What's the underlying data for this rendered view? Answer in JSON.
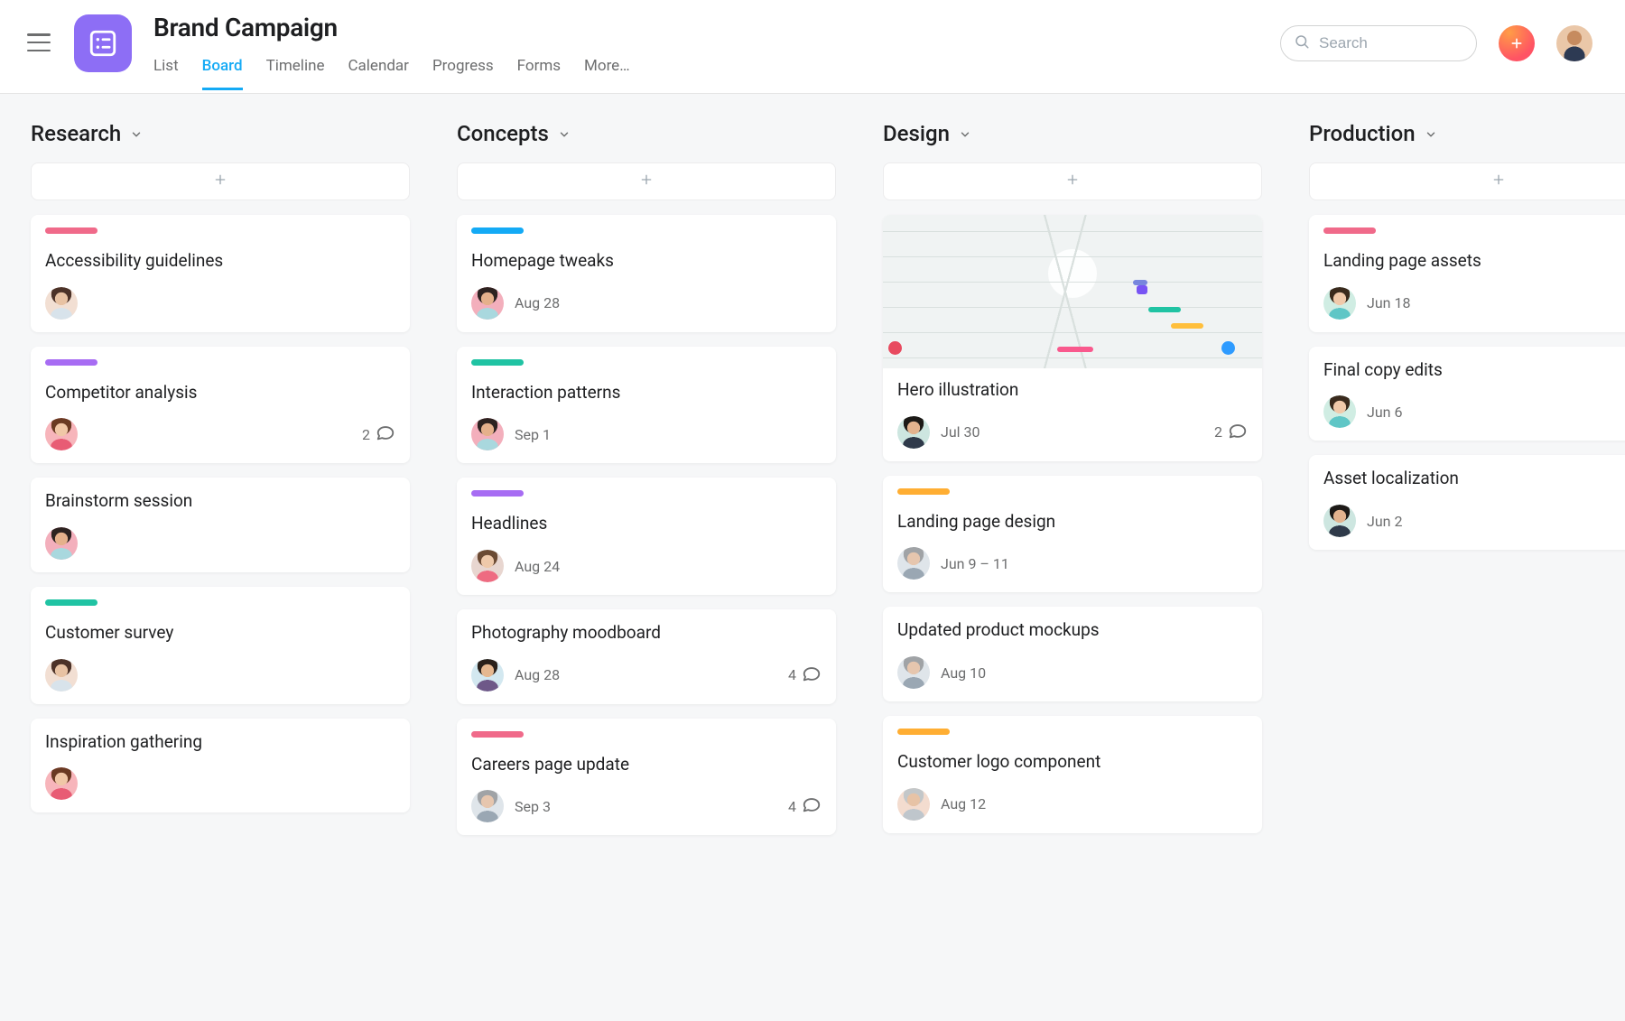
{
  "project": {
    "title": "Brand Campaign"
  },
  "tabs": [
    "List",
    "Board",
    "Timeline",
    "Calendar",
    "Progress",
    "Forms",
    "More…"
  ],
  "active_tab_index": 1,
  "search": {
    "placeholder": "Search"
  },
  "colors": {
    "pink": "#f06a8a",
    "purple": "#a76cf3",
    "teal": "#20c3a3",
    "blue": "#14aaf5",
    "orange": "#ffae33"
  },
  "columns": [
    {
      "name": "Research",
      "cards": [
        {
          "tag": "pink",
          "title": "Accessibility guidelines",
          "avatar": "a"
        },
        {
          "tag": "purple",
          "title": "Competitor analysis",
          "avatar": "b",
          "comments": 2
        },
        {
          "title": "Brainstorm session",
          "avatar": "c"
        },
        {
          "tag": "teal",
          "title": "Customer survey",
          "avatar": "a"
        },
        {
          "title": "Inspiration gathering",
          "avatar": "b"
        }
      ]
    },
    {
      "name": "Concepts",
      "cards": [
        {
          "tag": "blue",
          "title": "Homepage tweaks",
          "avatar": "c",
          "date": "Aug 28"
        },
        {
          "tag": "teal",
          "title": "Interaction patterns",
          "avatar": "c",
          "date": "Sep 1"
        },
        {
          "tag": "purple",
          "title": "Headlines",
          "avatar": "g",
          "date": "Aug 24"
        },
        {
          "title": "Photography moodboard",
          "avatar": "h",
          "date": "Aug 28",
          "comments": 4
        },
        {
          "tag": "pink",
          "title": "Careers page update",
          "avatar": "e",
          "date": "Sep 3",
          "comments": 4
        }
      ]
    },
    {
      "name": "Design",
      "cards": [
        {
          "cover": true,
          "title": "Hero illustration",
          "avatar": "d",
          "date": "Jul 30",
          "comments": 2
        },
        {
          "tag": "orange",
          "title": "Landing page design",
          "avatar": "e",
          "date": "Jun 9 – 11"
        },
        {
          "title": "Updated product mockups",
          "avatar": "e",
          "date": "Aug 10"
        },
        {
          "tag": "orange",
          "title": "Customer logo component",
          "avatar": "grey",
          "date": "Aug 12"
        }
      ]
    },
    {
      "name": "Production",
      "cards": [
        {
          "tag": "pink",
          "title": "Landing page assets",
          "avatar": "f",
          "date": "Jun 18"
        },
        {
          "title": "Final copy edits",
          "avatar": "f",
          "date": "Jun 6"
        },
        {
          "title": "Asset localization",
          "avatar": "d",
          "date": "Jun 2"
        }
      ]
    }
  ]
}
